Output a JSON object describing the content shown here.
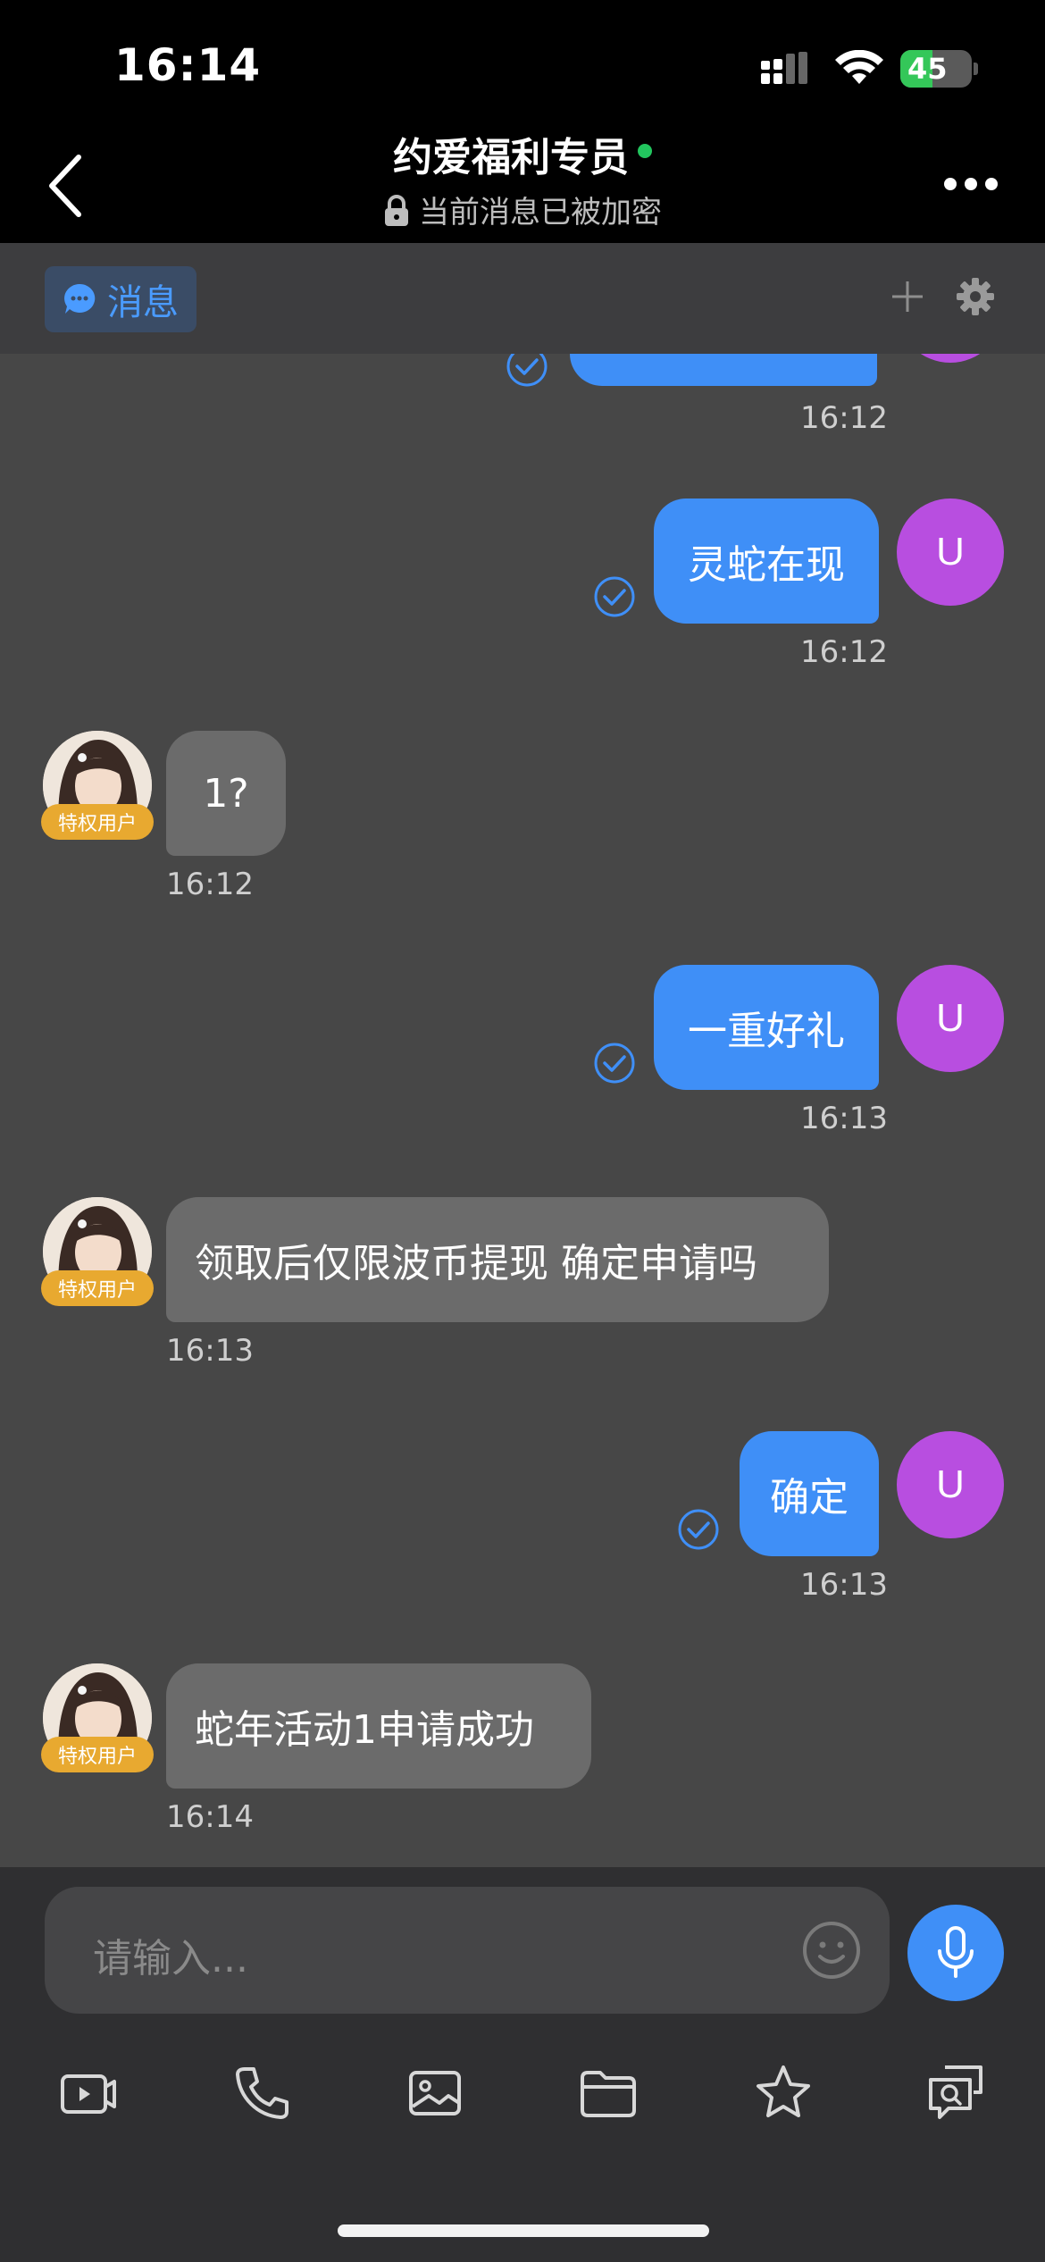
{
  "status_bar": {
    "time": "16:14",
    "battery": "45",
    "battery_level": 0.45
  },
  "header": {
    "title": "约爱福利专员",
    "subtitle": "当前消息已被加密"
  },
  "tabs": {
    "active_label": "消息"
  },
  "messages": [
    {
      "side": "out",
      "text": "",
      "time": "16:12"
    },
    {
      "side": "out",
      "text": "灵蛇在现",
      "time": "16:12",
      "avatar": "U"
    },
    {
      "side": "in",
      "text": "1?",
      "time": "16:12",
      "badge": "特权用户"
    },
    {
      "side": "out",
      "text": "一重好礼",
      "time": "16:13",
      "avatar": "U"
    },
    {
      "side": "in",
      "text": "领取后仅限波币提现 确定申请吗",
      "time": "16:13",
      "badge": "特权用户"
    },
    {
      "side": "out",
      "text": "确定",
      "time": "16:13",
      "avatar": "U"
    },
    {
      "side": "in",
      "text": "蛇年活动1申请成功",
      "time": "16:14",
      "badge": "特权用户"
    }
  ],
  "input": {
    "placeholder": "请输入..."
  },
  "toolbar": [
    "video-call-icon",
    "phone-icon",
    "image-icon",
    "folder-icon",
    "star-icon",
    "search-chat-icon"
  ],
  "colors": {
    "accent": "#3f8ff7",
    "avatar": "#b84ee0",
    "badge": "#e8a930",
    "online": "#22c55e"
  }
}
